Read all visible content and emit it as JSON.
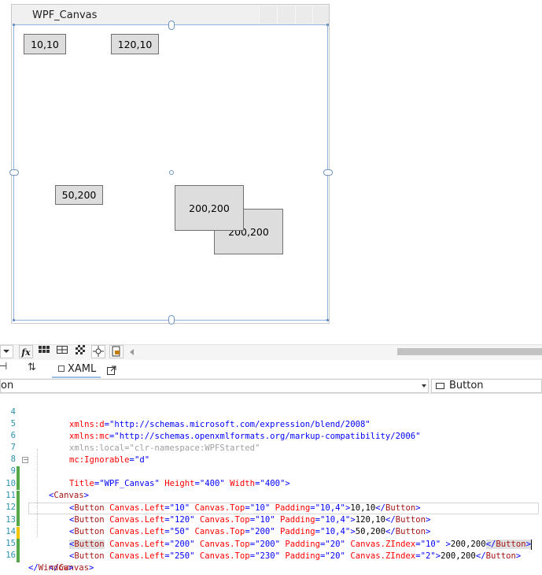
{
  "designer": {
    "window_title": "WPF_Canvas",
    "buttons": [
      {
        "label": "10,10"
      },
      {
        "label": "120,10"
      },
      {
        "label": "50,200"
      },
      {
        "label": "200,200"
      },
      {
        "label": "200,200"
      }
    ]
  },
  "toolbar": {
    "fx_label": "fx"
  },
  "tabs": {
    "swap_glyph": "⇅",
    "xaml_label": "XAML",
    "left_glyph": "→"
  },
  "nav": {
    "left_value": "on",
    "right_value": "Button"
  },
  "editor": {
    "lines": [
      {
        "num": "4"
      },
      {
        "num": "5"
      },
      {
        "num": "6"
      },
      {
        "num": "7"
      },
      {
        "num": "8"
      },
      {
        "num": "9"
      },
      {
        "num": "10"
      },
      {
        "num": "11"
      },
      {
        "num": "12"
      },
      {
        "num": "13"
      },
      {
        "num": "14"
      },
      {
        "num": "15"
      },
      {
        "num": "16"
      }
    ],
    "text": {
      "l4_attr": "xmlns:d",
      "l4_val": "\"http://schemas.microsoft.com/expression/blend/2008\"",
      "l5_attr": "xmlns:mc",
      "l5_val": "\"http://schemas.openxmlformats.org/markup-compatibility/2006\"",
      "l6": "xmlns:local=\"clr-namespace:WPFStarted\"",
      "l7_attr": "mc:Ignorable",
      "l7_val": "\"d\"",
      "l8_a1": "Title",
      "l8_v1": "\"WPF_Canvas\"",
      "l8_a2": "Height",
      "l8_v2": "\"400\"",
      "l8_a3": "Width",
      "l8_v3": "\"400\"",
      "l9_tag": "Canvas",
      "btn_tag": "Button",
      "a_left": "Canvas.Left",
      "a_top": "Canvas.Top",
      "a_pad": "Padding",
      "a_z": "Canvas.ZIndex",
      "l10_left": "\"10\"",
      "l10_top": "\"10\"",
      "l10_pad": "\"10,4\"",
      "l10_content": "10,10",
      "l11_left": "\"120\"",
      "l11_top": "\"10\"",
      "l11_pad": "\"10,4\"",
      "l11_content": "120,10",
      "l12_left": "\"50\"",
      "l12_top": "\"200\"",
      "l12_pad": "\"10,4\"",
      "l12_content": "50,200",
      "l13_left": "\"200\"",
      "l13_top": "\"200\"",
      "l13_pad": "\"20\"",
      "l13_z": "\"10\"",
      "l13_content": "200,200",
      "l14_left": "\"250\"",
      "l14_top": "\"230\"",
      "l14_pad": "\"20\"",
      "l14_z": "\"2\"",
      "l14_content": "200,200",
      "l15_tag": "Canvas",
      "l16_tag": "Window"
    }
  }
}
